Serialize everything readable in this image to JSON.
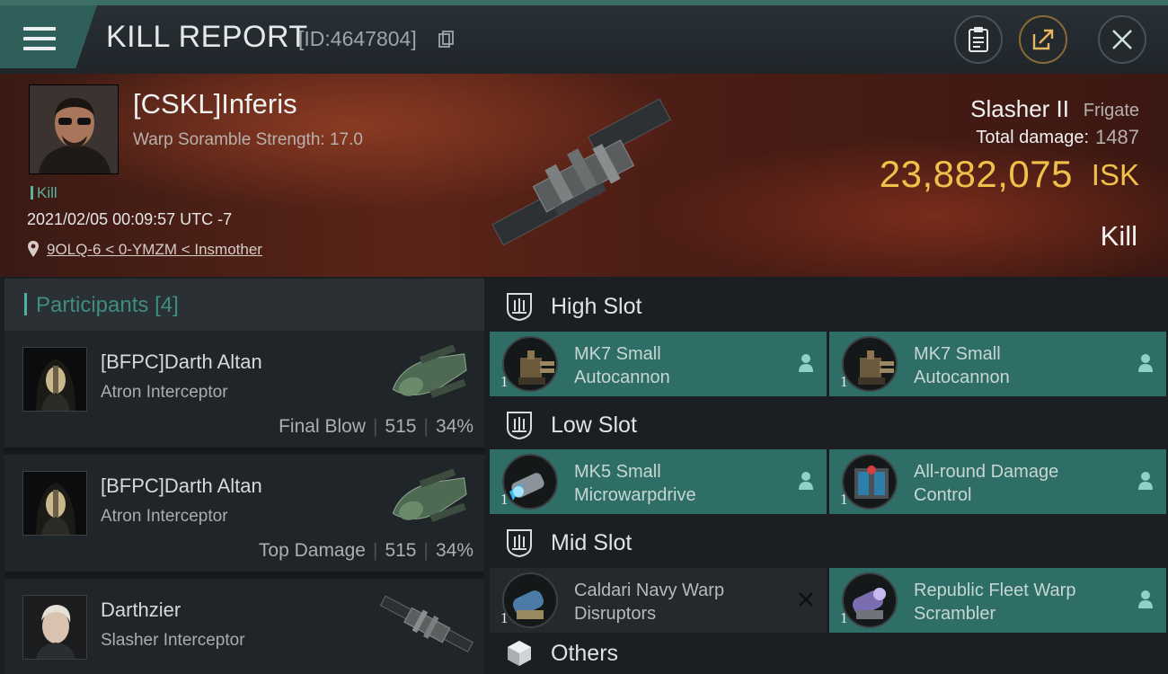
{
  "header": {
    "title": "KILL REPORT",
    "report_id": "[ID:4647804]",
    "buttons": [
      "clipboard-icon",
      "share-icon",
      "close-icon"
    ]
  },
  "victim": {
    "name": "[CSKL]Inferis",
    "subtitle": "Warp Soramble Strength: 17.0",
    "tag": "Kill",
    "datetime": "2021/02/05 00:09:57 UTC -7",
    "location": "9OLQ-6 < 0-YMZM < Insmother",
    "ship_name": "Slasher II",
    "ship_class": "Frigate",
    "damage_label": "Total damage:",
    "damage_value": "1487",
    "isk_value": "23,882,075",
    "isk_unit": "ISK",
    "result": "Kill"
  },
  "participants": {
    "title": "Participants",
    "count": "[4]",
    "items": [
      {
        "name": "[BFPC]Darth Altan",
        "ship": "Atron Interceptor",
        "role": "Final Blow",
        "damage": "515",
        "percent": "34%"
      },
      {
        "name": "[BFPC]Darth Altan",
        "ship": "Atron Interceptor",
        "role": "Top Damage",
        "damage": "515",
        "percent": "34%"
      },
      {
        "name": "Darthzier",
        "ship": "Slasher Interceptor",
        "role": "",
        "damage": "",
        "percent": ""
      }
    ]
  },
  "slots": {
    "high": {
      "title": "High Slot",
      "modules": [
        {
          "name_line1": "MK7 Small",
          "name_line2": "Autocannon",
          "qty": "1",
          "status": "active"
        },
        {
          "name_line1": "MK7 Small",
          "name_line2": "Autocannon",
          "qty": "1",
          "status": "active"
        }
      ]
    },
    "low": {
      "title": "Low Slot",
      "modules": [
        {
          "name_line1": "MK5 Small",
          "name_line2": "Microwarpdrive",
          "qty": "1",
          "status": "active"
        },
        {
          "name_line1": "All-round Damage",
          "name_line2": "Control",
          "qty": "1",
          "status": "active"
        }
      ]
    },
    "mid": {
      "title": "Mid Slot",
      "modules": [
        {
          "name_line1": "Caldari Navy Warp",
          "name_line2": "Disruptors",
          "qty": "1",
          "status": "destroyed"
        },
        {
          "name_line1": "Republic Fleet Warp",
          "name_line2": "Scrambler",
          "qty": "1",
          "status": "active"
        }
      ]
    },
    "others": {
      "title": "Others"
    }
  },
  "colors": {
    "accent_teal": "#2f6e66",
    "isk_gold": "#f0c04a",
    "kill_green": "#56b3a1"
  }
}
